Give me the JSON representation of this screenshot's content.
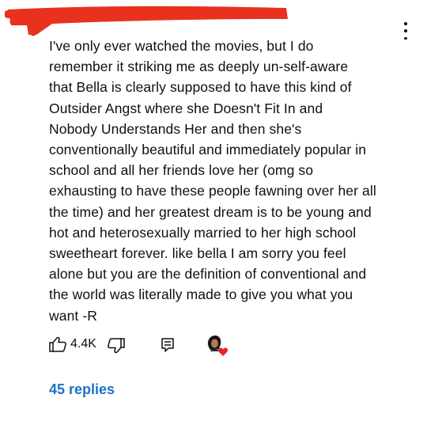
{
  "comment": {
    "text": "I've only ever watched the movies, but I do\nremember it striking me as deeply un-self-aware\nthat Bella is clearly supposed to have this kind of\nOutsider Angst where she Doesn't Fit In and\nNobody Understands Her and then she's\nconventionally beautiful and immediately popular in\nschool and all her friends love her (omg so\nexhausting to have these people fawning over her all\nthe time) and her greatest dream is to be young and\nhot and heterosexually married to her high school\nsweetheart forever. like bella I am sorry you feel\nalone but you are the definition of conventional and\nthe world was literally made to give you what you\nwant -R"
  },
  "actions": {
    "like_count": "4.4K"
  },
  "replies_label": "45 replies",
  "icons": [
    "more-vert-icon",
    "thumbs-up-icon",
    "thumbs-down-icon",
    "reply-icon",
    "creator-heart-icon"
  ],
  "colors": {
    "redaction": "#e8321e",
    "replies_link": "#1a73c8",
    "heart": "#e5252a"
  }
}
